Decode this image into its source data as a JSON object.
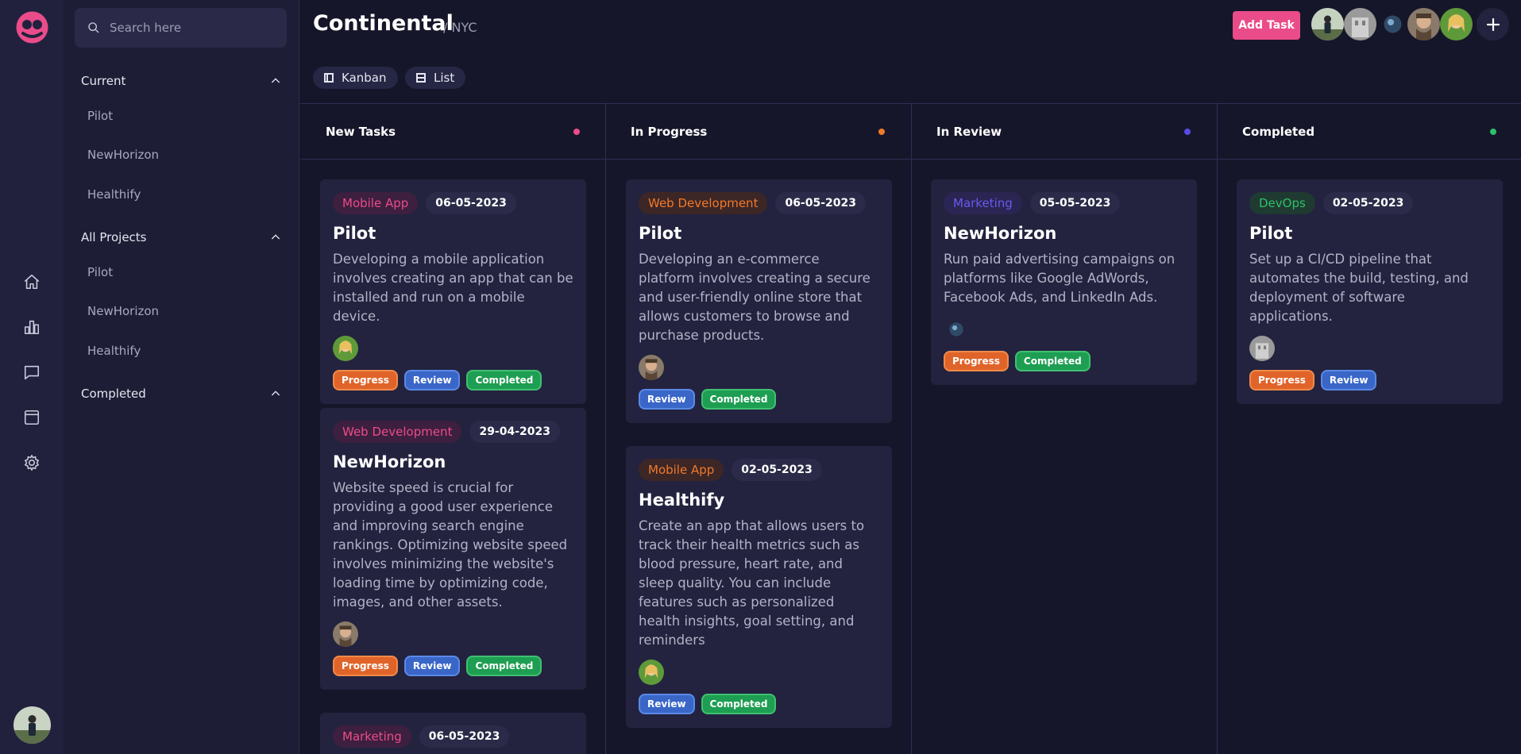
{
  "sidebar": {
    "search_placeholder": "Search here",
    "sections": [
      {
        "label": "Current",
        "items": [
          "Pilot",
          "NewHorizon",
          "Healthify"
        ]
      },
      {
        "label": "All Projects",
        "items": [
          "Pilot",
          "NewHorizon",
          "Healthify"
        ]
      },
      {
        "label": "Completed",
        "items": []
      }
    ]
  },
  "rail": {
    "icons": [
      "home-icon",
      "chart-icon",
      "chat-icon",
      "calendar-icon",
      "gear-icon"
    ]
  },
  "header": {
    "title": "Continental",
    "subtitle": "/ NYC",
    "views": [
      "Kanban",
      "List"
    ],
    "add_task_label": "Add Task"
  },
  "colors": {
    "accent": "#ea4c89",
    "new_tasks_dot": "#ea4c89",
    "in_progress_dot": "#f07a2a",
    "in_review_dot": "#5a4ae6",
    "completed_dot": "#2ec16a"
  },
  "board": {
    "columns": [
      {
        "title": "New Tasks",
        "cards": [
          {
            "category": "Mobile App",
            "date": "06-05-2023",
            "title": "Pilot",
            "description": "Developing a mobile application involves creating an app that can be installed and run on a mobile device.",
            "tags": [
              "Progress",
              "Review",
              "Completed"
            ]
          },
          {
            "category": "Web Development",
            "date": "29-04-2023",
            "title": "NewHorizon",
            "description": "Website speed is crucial for providing a good user experience and improving search engine rankings. Optimizing website speed involves minimizing the website's loading time by optimizing code, images, and other assets.",
            "tags": [
              "Progress",
              "Review",
              "Completed"
            ]
          },
          {
            "category": "Marketing",
            "date": "06-05-2023"
          }
        ]
      },
      {
        "title": "In Progress",
        "cards": [
          {
            "category": "Web Development",
            "date": "06-05-2023",
            "title": "Pilot",
            "description": "Developing an e-commerce platform involves creating a secure and user-friendly online store that allows customers to browse and purchase products.",
            "tags": [
              "Review",
              "Completed"
            ]
          },
          {
            "category": "Mobile App",
            "date": "02-05-2023",
            "title": "Healthify",
            "description": "Create an app that allows users to track their health metrics such as blood pressure, heart rate, and sleep quality. You can include features such as personalized health insights, goal setting, and reminders",
            "tags": [
              "Review",
              "Completed"
            ]
          }
        ]
      },
      {
        "title": "In Review",
        "cards": [
          {
            "category": "Marketing",
            "date": "05-05-2023",
            "title": "NewHorizon",
            "description": "Run paid advertising campaigns on platforms like Google AdWords, Facebook Ads, and LinkedIn Ads.",
            "tags": [
              "Progress",
              "Completed"
            ]
          }
        ]
      },
      {
        "title": "Completed",
        "cards": [
          {
            "category": "DevOps",
            "date": "02-05-2023",
            "title": "Pilot",
            "description": "Set up a CI/CD pipeline that automates the build, testing, and deployment of software applications.",
            "tags": [
              "Progress",
              "Review"
            ]
          }
        ]
      }
    ]
  }
}
